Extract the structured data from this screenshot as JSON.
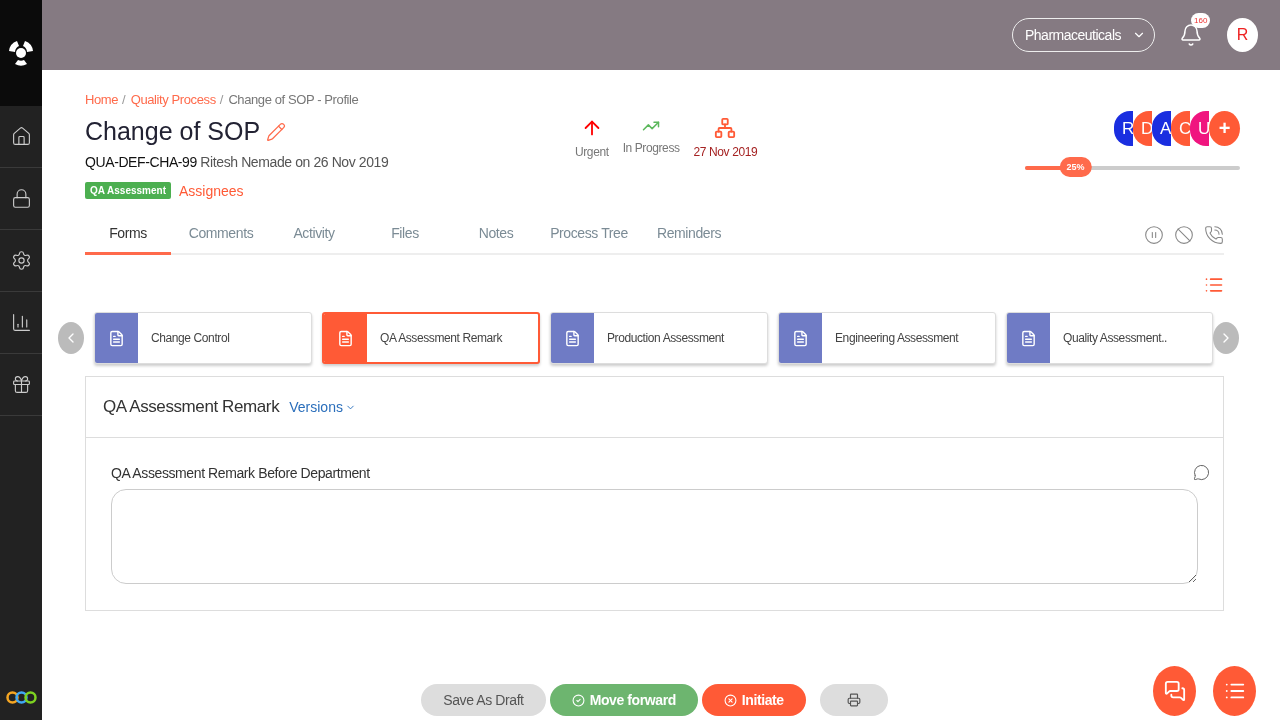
{
  "header": {
    "organization": "Pharmaceuticals",
    "notifications": "160",
    "user_initial": "R"
  },
  "breadcrumb": [
    {
      "kind": "link",
      "label": "Home",
      "separator": "/"
    },
    {
      "kind": "link",
      "label": "Quality Process",
      "separator": "/"
    },
    {
      "kind": "current",
      "label": "Change of SOP - Profile"
    }
  ],
  "title": "Change of SOP",
  "meta": {
    "code": "QUA-DEF-CHA-99",
    "by": "Ritesh Nemade on 26 Nov 2019"
  },
  "stage_badge": "QA Assessment",
  "assignees_link": "Assignees",
  "status": [
    {
      "kind": "priority",
      "label": "Urgent"
    },
    {
      "kind": "progress",
      "label": "In Progress"
    },
    {
      "kind": "due",
      "label": "27 Nov 2019"
    }
  ],
  "assignee_avatars": [
    {
      "initial": "R",
      "color": "#1a2ee0"
    },
    {
      "initial": "D",
      "color": "#ff5a36"
    },
    {
      "initial": "A",
      "color": "#1a2ee0"
    },
    {
      "initial": "C",
      "color": "#ff5a36"
    },
    {
      "initial": "U",
      "color": "#f0157f"
    }
  ],
  "add_assignee": "+",
  "progress": {
    "level": 0.25,
    "reading": "25%"
  },
  "tabs": [
    {
      "label": "Forms",
      "selected": true
    },
    {
      "label": "Comments",
      "selected": false
    },
    {
      "label": "Activity",
      "selected": false
    },
    {
      "label": "Files",
      "selected": false
    },
    {
      "label": "Notes",
      "selected": false
    },
    {
      "label": "Process Tree",
      "selected": false
    },
    {
      "label": "Reminders",
      "selected": false
    }
  ],
  "forms": [
    {
      "label": "Change Control",
      "selected": false
    },
    {
      "label": "QA Assessment Remark",
      "selected": true
    },
    {
      "label": "Production Assessment",
      "selected": false
    },
    {
      "label": "Engineering Assessment",
      "selected": false
    },
    {
      "label": "Quality Assessment..",
      "selected": false
    }
  ],
  "form_panel": {
    "title": "QA Assessment Remark",
    "versions": "Versions",
    "field_label": "QA Assessment Remark Before Department"
  },
  "actions": [
    {
      "kind": "draft",
      "label": "Save As Draft"
    },
    {
      "kind": "forward",
      "label": "Move forward"
    },
    {
      "kind": "initiate",
      "label": "Initiate"
    },
    {
      "kind": "print"
    }
  ]
}
